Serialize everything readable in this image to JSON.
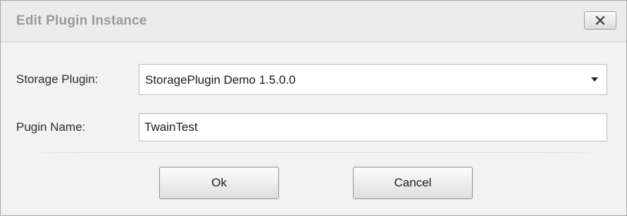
{
  "dialog": {
    "title": "Edit Plugin Instance",
    "close_icon": "close-x-icon"
  },
  "form": {
    "storage_plugin": {
      "label": "Storage Plugin:",
      "selected_value": "StoragePlugin Demo 1.5.0.0",
      "dropdown_icon": "chevron-down-icon"
    },
    "plugin_name": {
      "label": "Pugin Name:",
      "value": "TwainTest"
    }
  },
  "buttons": {
    "ok_label": "Ok",
    "cancel_label": "Cancel"
  },
  "colors": {
    "title_text": "#9a9a9a",
    "dialog_background": "#f2f2f2",
    "input_background": "#ffffff"
  }
}
